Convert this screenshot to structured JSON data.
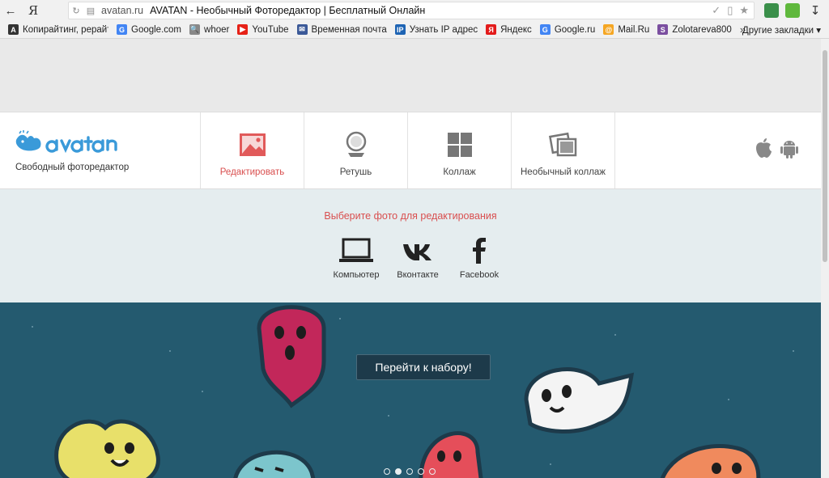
{
  "browser": {
    "back_icon": "arrow-left-icon",
    "yandex_glyph": "Я",
    "url_domain": "avatan.ru",
    "page_title": "AVATAN - Необычный Фоторедактор | Бесплатный Онлайн",
    "bookmarks": [
      {
        "label": "Копирайтинг, рерайт",
        "icon": "A",
        "color": "#333333"
      },
      {
        "label": "Google.com",
        "icon": "G",
        "color": "#4285f4"
      },
      {
        "label": "whoer",
        "icon": "🔍",
        "color": "#888888"
      },
      {
        "label": "YouTube",
        "icon": "▶",
        "color": "#e62117"
      },
      {
        "label": "Временная почта",
        "icon": "✉",
        "color": "#3b5998"
      },
      {
        "label": "Узнать IP адрес",
        "icon": "IP",
        "color": "#1e64b4"
      },
      {
        "label": "Яндекс",
        "icon": "Я",
        "color": "#e31b1b"
      },
      {
        "label": "Google.ru",
        "icon": "G",
        "color": "#4285f4"
      },
      {
        "label": "Mail.Ru",
        "icon": "@",
        "color": "#f5a623"
      },
      {
        "label": "Zolotareva800",
        "icon": "S",
        "color": "#7b4fa0"
      }
    ],
    "more": "»",
    "other_bookmarks": "Другие закладки ▾"
  },
  "site": {
    "tagline": "Свободный фоторедактор",
    "menu": [
      {
        "label": "Редактировать",
        "icon": "picture-icon"
      },
      {
        "label": "Ретушь",
        "icon": "mirror-icon"
      },
      {
        "label": "Коллаж",
        "icon": "grid-icon"
      },
      {
        "label": "Необычный коллаж",
        "icon": "stacked-photos-icon"
      }
    ],
    "picker_title": "Выберите фото для редактирования",
    "sources": [
      {
        "label": "Компьютер",
        "icon": "laptop-icon"
      },
      {
        "label": "Вконтакте",
        "icon": "vk-icon"
      },
      {
        "label": "Facebook",
        "icon": "facebook-icon"
      }
    ],
    "cta": "Перейти к набору!",
    "slides_count": 5,
    "active_slide": 2
  },
  "colors": {
    "accent_red": "#d94f4f",
    "brand_blue": "#3a9ad9",
    "hero_bg": "#245a6f"
  }
}
